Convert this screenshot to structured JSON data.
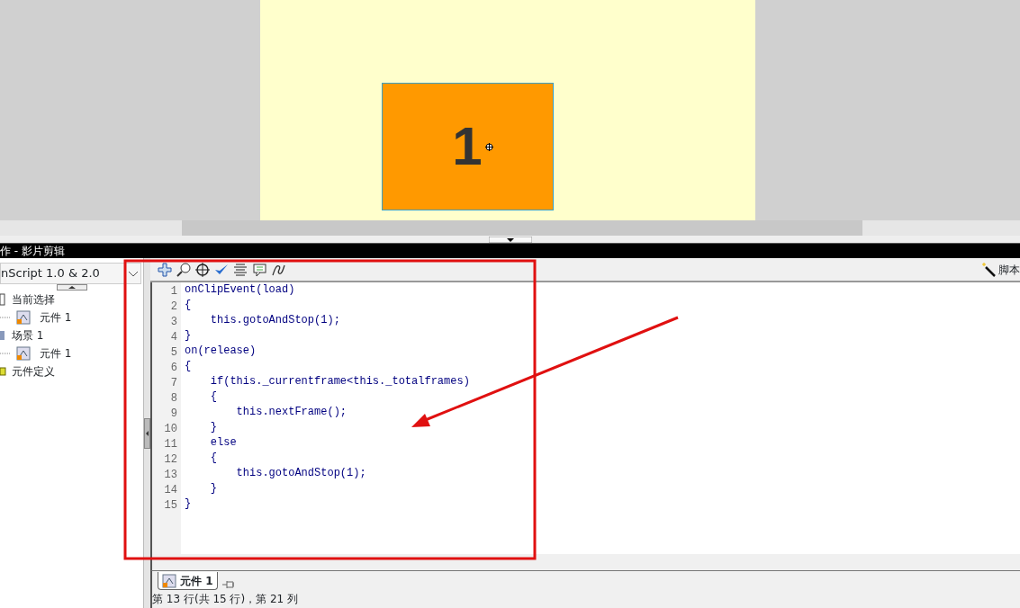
{
  "stage": {
    "symbol_label": "1"
  },
  "panel": {
    "title": "作 - 影片剪辑"
  },
  "sidebar": {
    "version_select": "nScript 1.0 & 2.0",
    "tree": [
      {
        "label": "当前选择",
        "children": [
          {
            "label": "元件 1"
          }
        ]
      },
      {
        "label": "场景 1",
        "children": [
          {
            "label": "元件 1"
          }
        ]
      },
      {
        "label": "元件定义"
      }
    ]
  },
  "toolbar": {
    "assist_label": "脚本"
  },
  "code_lines": [
    {
      "number": "1",
      "text": "onClipEvent(load)"
    },
    {
      "number": "2",
      "text": "{"
    },
    {
      "number": "3",
      "text": "    this.gotoAndStop(1);"
    },
    {
      "number": "4",
      "text": "}"
    },
    {
      "number": "5",
      "text": "on(release)"
    },
    {
      "number": "6",
      "text": "{"
    },
    {
      "number": "7",
      "text": "    if(this._currentframe<this._totalframes)"
    },
    {
      "number": "8",
      "text": "    {"
    },
    {
      "number": "9",
      "text": "        this.nextFrame();"
    },
    {
      "number": "10",
      "text": "    }"
    },
    {
      "number": "11",
      "text": "    else"
    },
    {
      "number": "12",
      "text": "    {"
    },
    {
      "number": "13",
      "text": "        this.gotoAndStop(1);"
    },
    {
      "number": "14",
      "text": "    }"
    },
    {
      "number": "15",
      "text": "}"
    }
  ],
  "tabs": [
    {
      "label": "元件 1",
      "selected": true
    }
  ],
  "status_bar": "第 13 行(共 15 行)，第 21 列"
}
